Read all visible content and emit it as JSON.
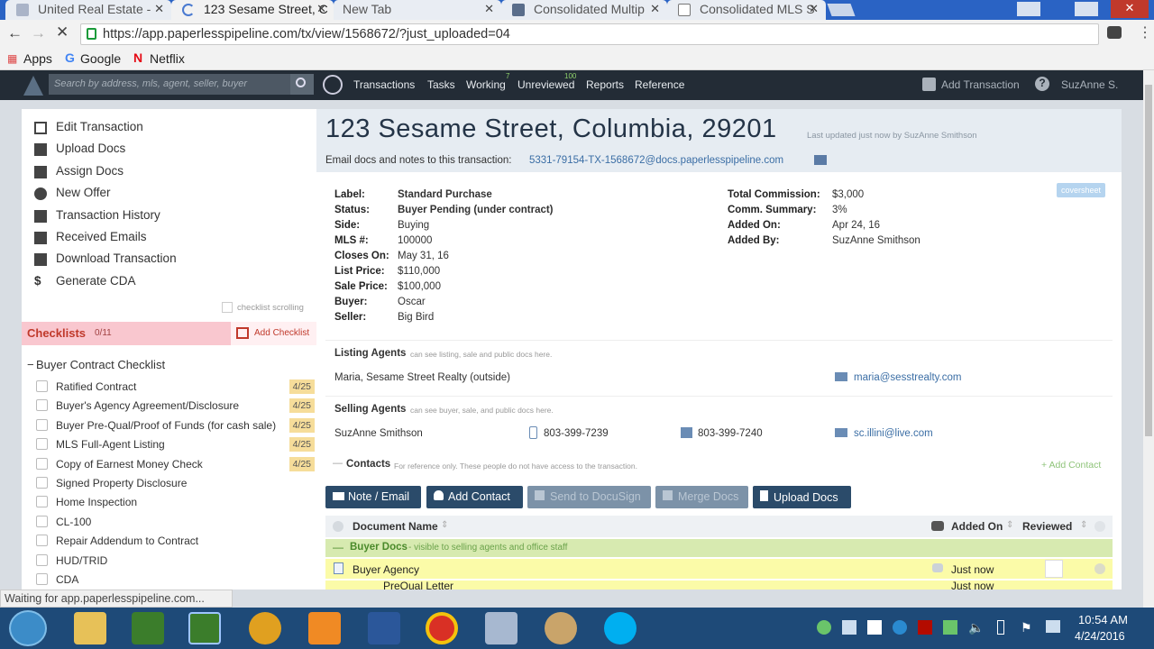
{
  "browser": {
    "tabs": [
      {
        "title": "United Real Estate -",
        "active": false
      },
      {
        "title": "123 Sesame Street, C",
        "active": true
      },
      {
        "title": "New Tab",
        "active": false
      },
      {
        "title": "Consolidated Multip",
        "active": false
      },
      {
        "title": "Consolidated MLS S",
        "active": false
      }
    ],
    "url": "https://app.paperlesspipeline.com/tx/view/1568672/?just_uploaded=04",
    "bookmarks": [
      "Apps",
      "Google",
      "Netflix"
    ],
    "status_text": "Waiting for app.paperlesspipeline.com..."
  },
  "nav": {
    "search_placeholder": "Search by address, mls, agent, seller, buyer",
    "links": [
      "Transactions",
      "Tasks",
      "Working",
      "Unreviewed",
      "Reports",
      "Reference"
    ],
    "working_badge": "7",
    "unreviewed_badge": "100",
    "add_transaction": "Add Transaction",
    "user": "SuzAnne S."
  },
  "sidebar": {
    "actions": [
      "Edit Transaction",
      "Upload Docs",
      "Assign Docs",
      "New Offer",
      "Transaction History",
      "Received Emails",
      "Download Transaction",
      "Generate CDA"
    ],
    "checklist_scrolling": "checklist scrolling",
    "checklists_label": "Checklists",
    "checklists_count": "0/11",
    "add_checklist": "Add Checklist",
    "checklist_title": "Buyer Contract Checklist",
    "items": [
      {
        "label": "Ratified Contract",
        "date": "4/25"
      },
      {
        "label": "Buyer's Agency Agreement/Disclosure",
        "date": "4/25"
      },
      {
        "label": "Buyer Pre-Qual/Proof of Funds (for cash sale)",
        "date": "4/25"
      },
      {
        "label": "MLS Full-Agent Listing",
        "date": "4/25"
      },
      {
        "label": "Copy of Earnest Money Check",
        "date": "4/25"
      },
      {
        "label": "Signed Property Disclosure",
        "date": ""
      },
      {
        "label": "Home Inspection",
        "date": ""
      },
      {
        "label": "CL-100",
        "date": ""
      },
      {
        "label": "Repair Addendum to Contract",
        "date": ""
      },
      {
        "label": "HUD/TRID",
        "date": ""
      },
      {
        "label": "CDA",
        "date": ""
      }
    ]
  },
  "main": {
    "title": "123 Sesame Street, Columbia, 29201",
    "last_updated": "Last updated just now by SuzAnne Smithson",
    "email_prefix": "Email docs and notes to this transaction:",
    "email": "5331-79154-TX-1568672@docs.paperlesspipeline.com",
    "coversheet": "coversheet",
    "details_left": [
      {
        "label": "Label:",
        "value": "Standard Purchase",
        "bold": true
      },
      {
        "label": "Status:",
        "value": "Buyer Pending (under contract)",
        "bold": true
      },
      {
        "label": "Side:",
        "value": "Buying"
      },
      {
        "label": "MLS #:",
        "value": "100000"
      },
      {
        "label": "Closes On:",
        "value": "May 31, 16"
      },
      {
        "label": "List Price:",
        "value": "$110,000"
      },
      {
        "label": "Sale Price:",
        "value": "$100,000"
      },
      {
        "label": "Buyer:",
        "value": "Oscar"
      },
      {
        "label": "Seller:",
        "value": "Big Bird"
      }
    ],
    "details_right": [
      {
        "label": "Total Commission:",
        "value": "$3,000"
      },
      {
        "label": "Comm. Summary:",
        "value": "3%"
      },
      {
        "label": "Added On:",
        "value": "Apr 24, 16"
      },
      {
        "label": "Added By:",
        "value": "SuzAnne Smithson"
      }
    ],
    "listing_agents_title": "Listing Agents",
    "listing_agents_note": "can see listing, sale and public docs here.",
    "listing_agent_name": "Maria, Sesame Street Realty (outside)",
    "listing_agent_email": "maria@sesstrealty.com",
    "selling_agents_title": "Selling Agents",
    "selling_agents_note": "can see buyer, sale, and public docs here.",
    "selling_agent_name": "SuzAnne Smithson",
    "selling_agent_phone": "803-399-7239",
    "selling_agent_fax": "803-399-7240",
    "selling_agent_email": "sc.illini@live.com",
    "contacts_title": "Contacts",
    "contacts_note": "For reference only. These people do not have access to the transaction.",
    "add_contact_link": "+ Add Contact",
    "buttons": [
      "Note / Email",
      "Add Contact",
      "Send to DocuSign",
      "Merge Docs",
      "Upload Docs"
    ],
    "doc_headers": {
      "name": "Document Name",
      "added": "Added On",
      "reviewed": "Reviewed"
    },
    "doc_group": "Buyer Docs",
    "doc_group_note": "- visible to selling agents and office staff",
    "docs": [
      {
        "name": "Buyer Agency",
        "added": "Just now"
      },
      {
        "name": "PreQual Letter",
        "added": "Just now"
      }
    ]
  },
  "taskbar": {
    "time": "10:54 AM",
    "date": "4/24/2016"
  }
}
